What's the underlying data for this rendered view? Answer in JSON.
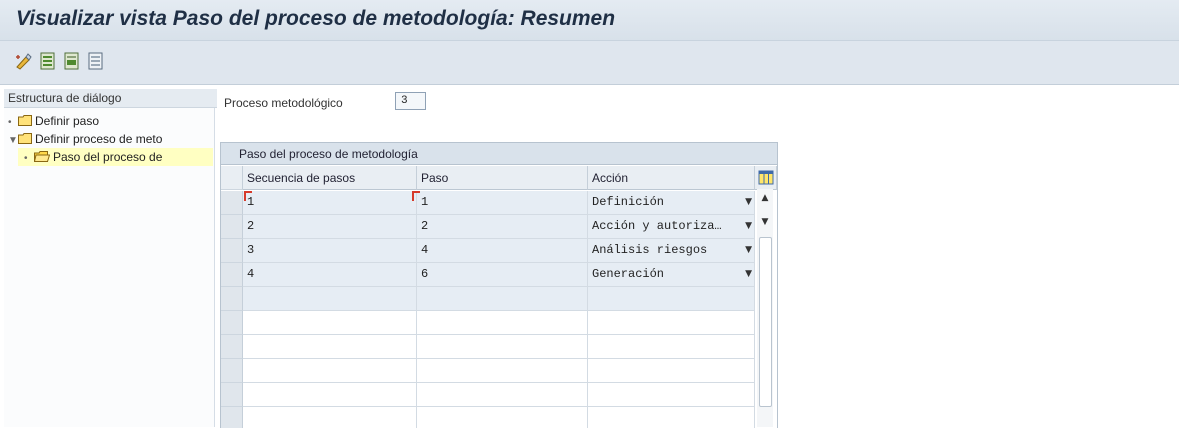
{
  "window": {
    "title": "Visualizar vista Paso del proceso de metodología: Resumen"
  },
  "toolbar": {
    "buttons": [
      {
        "icon": "change-display-icon"
      },
      {
        "icon": "select-all-icon"
      },
      {
        "icon": "select-block-icon"
      },
      {
        "icon": "deselect-all-icon"
      }
    ]
  },
  "tree": {
    "header": "Estructura de diálogo",
    "items": [
      {
        "label": "Definir paso",
        "expanded": false,
        "selected": false
      },
      {
        "label": "Definir proceso de meto",
        "expanded": true,
        "selected": false
      },
      {
        "label": "Paso del proceso de",
        "expanded": false,
        "selected": true
      }
    ]
  },
  "form": {
    "proceso_label": "Proceso metodológico",
    "proceso_value": "3"
  },
  "grid": {
    "title": "Paso del proceso de metodología",
    "columns": [
      "Secuencia de pasos",
      "Paso",
      "Acción"
    ],
    "rows": [
      {
        "secuencia": "1",
        "paso": "1",
        "accion": "Definición"
      },
      {
        "secuencia": "2",
        "paso": "2",
        "accion": "Acción y autoriza…"
      },
      {
        "secuencia": "3",
        "paso": "4",
        "accion": "Análisis riesgos"
      },
      {
        "secuencia": "4",
        "paso": "6",
        "accion": "Generación"
      }
    ],
    "empty_rows": 6,
    "config_icon": "table-settings-icon"
  },
  "colors": {
    "title_text": "#1f2f45",
    "selected_tree_bg": "#ffffc2",
    "filled_cell_bg": "#e6edf4",
    "folder_yellow": "#f2c418"
  }
}
